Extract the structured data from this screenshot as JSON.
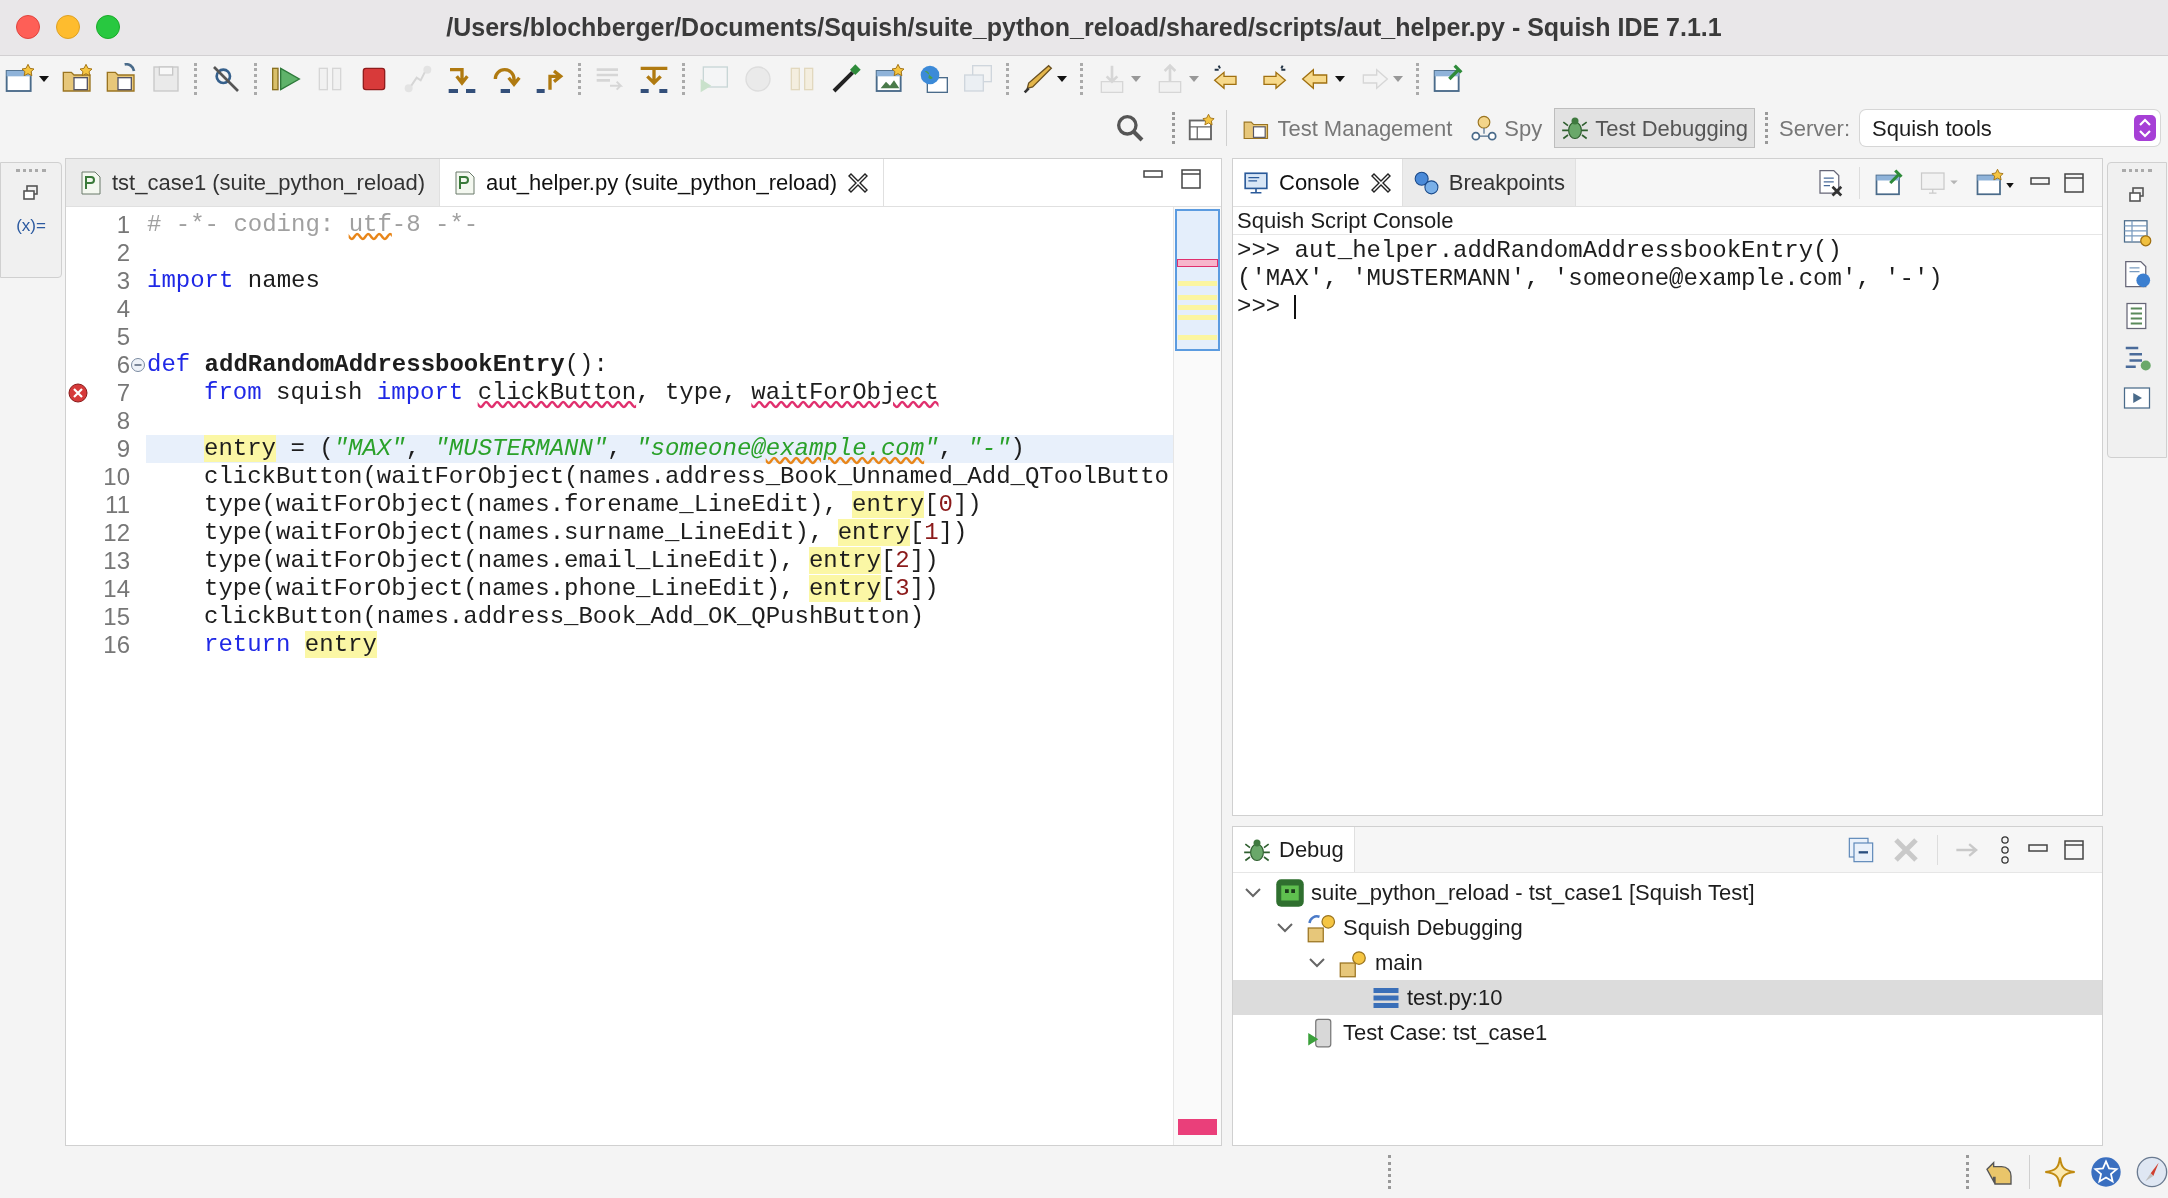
{
  "window": {
    "title": "/Users/blochberger/Documents/Squish/suite_python_reload/shared/scripts/aut_helper.py - Squish IDE 7.1.1"
  },
  "toolbar": [
    {
      "kind": "window-new",
      "disabled": false,
      "dropdown": true
    },
    {
      "kind": "folder-new",
      "disabled": false,
      "dropdown": false
    },
    {
      "kind": "folder-open",
      "disabled": false,
      "dropdown": false
    },
    {
      "kind": "save",
      "disabled": true,
      "dropdown": false
    },
    {
      "kind": "separator"
    },
    {
      "kind": "search-off",
      "disabled": false,
      "dropdown": false
    },
    {
      "kind": "separator"
    },
    {
      "kind": "run",
      "disabled": false,
      "dropdown": false
    },
    {
      "kind": "pause",
      "disabled": true,
      "dropdown": false
    },
    {
      "kind": "stop",
      "disabled": false,
      "dropdown": false
    },
    {
      "kind": "disconnect",
      "disabled": true,
      "dropdown": false
    },
    {
      "kind": "step-into",
      "disabled": false,
      "dropdown": false
    },
    {
      "kind": "step-over",
      "disabled": false,
      "dropdown": false
    },
    {
      "kind": "step-return",
      "disabled": false,
      "dropdown": false
    },
    {
      "kind": "separator"
    },
    {
      "kind": "list",
      "disabled": true,
      "dropdown": false
    },
    {
      "kind": "step-all",
      "disabled": false,
      "dropdown": false
    },
    {
      "kind": "separator"
    },
    {
      "kind": "record-window",
      "disabled": true,
      "dropdown": false
    },
    {
      "kind": "record",
      "disabled": true,
      "dropdown": false
    },
    {
      "kind": "pause-gold",
      "disabled": true,
      "dropdown": false
    },
    {
      "kind": "eyedropper",
      "disabled": false,
      "dropdown": false
    },
    {
      "kind": "image-new",
      "disabled": false,
      "dropdown": false
    },
    {
      "kind": "globe",
      "disabled": false,
      "dropdown": false
    },
    {
      "kind": "windows",
      "disabled": true,
      "dropdown": false
    },
    {
      "kind": "separator"
    },
    {
      "kind": "pen",
      "disabled": false,
      "dropdown": true
    },
    {
      "kind": "separator"
    },
    {
      "kind": "import",
      "disabled": true,
      "dropdown": true
    },
    {
      "kind": "export",
      "disabled": true,
      "dropdown": true
    },
    {
      "kind": "back-star",
      "disabled": false,
      "dropdown": false
    },
    {
      "kind": "forward-star",
      "disabled": false,
      "dropdown": false
    },
    {
      "kind": "back",
      "disabled": false,
      "dropdown": true
    },
    {
      "kind": "forward",
      "disabled": true,
      "dropdown": true
    },
    {
      "kind": "separator"
    },
    {
      "kind": "pin-window",
      "disabled": false,
      "dropdown": false
    }
  ],
  "perspectives": [
    {
      "label": "Test Management",
      "kind": "folder",
      "selected": false
    },
    {
      "label": "Spy",
      "kind": "spy",
      "selected": false
    },
    {
      "label": "Test Debugging",
      "kind": "bug",
      "selected": true
    }
  ],
  "server": {
    "label": "Server:",
    "value": "Squish tools"
  },
  "left_strip": {
    "label": "(x)="
  },
  "editor": {
    "tabs": [
      {
        "label": "tst_case1 (suite_python_reload)",
        "selected": false,
        "closable": false
      },
      {
        "label": "aut_helper.py (suite_python_reload)",
        "selected": true,
        "closable": true
      }
    ],
    "lines": [
      {
        "number": "1",
        "current": false,
        "error": false,
        "fold": false,
        "indented": false,
        "tokens": [
          {
            "kind": "comment",
            "text": "# -*- coding: "
          },
          {
            "kind": "comment",
            "text": "utf",
            "warning": true
          },
          {
            "kind": "comment",
            "text": "-8 -*-"
          }
        ]
      },
      {
        "number": "2",
        "error": false,
        "fold": false
      },
      {
        "number": "3",
        "current": false,
        "error": false,
        "fold": false,
        "indented": false,
        "tokens": [
          {
            "kind": "keyword",
            "text": "import"
          },
          {
            "kind": "plain",
            "text": " names"
          }
        ]
      },
      {
        "number": "4",
        "error": false,
        "fold": false
      },
      {
        "number": "5",
        "error": false,
        "fold": false
      },
      {
        "number": "6",
        "current": false,
        "error": false,
        "fold": true,
        "indented": false,
        "tokens": [
          {
            "kind": "keyword",
            "text": "def "
          },
          {
            "kind": "defname",
            "text": "addRandomAddressbookEntry"
          },
          {
            "kind": "plain",
            "text": "():"
          }
        ]
      },
      {
        "number": "7",
        "current": false,
        "error": true,
        "fold": false,
        "indented": true,
        "tokens": [
          {
            "kind": "keyword",
            "text": "from"
          },
          {
            "kind": "plain",
            "text": " squish "
          },
          {
            "kind": "keyword",
            "text": "import "
          },
          {
            "kind": "plain",
            "text": "clickButton",
            "error": true
          },
          {
            "kind": "plain",
            "text": ", type, "
          },
          {
            "kind": "plain",
            "text": "waitForObject",
            "error": true
          }
        ]
      },
      {
        "number": "8",
        "error": false,
        "fold": false
      },
      {
        "number": "9",
        "current": true,
        "error": false,
        "fold": false,
        "indented": true,
        "tokens": [
          {
            "kind": "occurrence",
            "text": "entry"
          },
          {
            "kind": "plain",
            "text": " = ("
          },
          {
            "kind": "string",
            "text": "\"MAX\""
          },
          {
            "kind": "plain",
            "text": ", "
          },
          {
            "kind": "string",
            "text": "\"MUSTERMANN\""
          },
          {
            "kind": "plain",
            "text": ", "
          },
          {
            "kind": "string",
            "text": "\"someone@"
          },
          {
            "kind": "string",
            "text": "example.com",
            "warning": true
          },
          {
            "kind": "string",
            "text": "\""
          },
          {
            "kind": "plain",
            "text": ", "
          },
          {
            "kind": "string",
            "text": "\"-\""
          },
          {
            "kind": "plain",
            "text": ")"
          }
        ]
      },
      {
        "number": "10",
        "current": false,
        "error": false,
        "fold": false,
        "indented": true,
        "tokens": [
          {
            "kind": "plain",
            "text": "clickButton(waitForObject(names.address_Book_Unnamed_Add_QToolButto"
          }
        ]
      },
      {
        "number": "11",
        "current": false,
        "error": false,
        "fold": false,
        "indented": true,
        "tokens": [
          {
            "kind": "plain",
            "text": "type(waitForObject(names.forename_LineEdit), "
          },
          {
            "kind": "occurrence",
            "text": "entry"
          },
          {
            "kind": "plain",
            "text": "["
          },
          {
            "kind": "number",
            "text": "0"
          },
          {
            "kind": "plain",
            "text": "])"
          }
        ]
      },
      {
        "number": "12",
        "current": false,
        "error": false,
        "fold": false,
        "indented": true,
        "tokens": [
          {
            "kind": "plain",
            "text": "type(waitForObject(names.surname_LineEdit), "
          },
          {
            "kind": "occurrence",
            "text": "entry"
          },
          {
            "kind": "plain",
            "text": "["
          },
          {
            "kind": "number",
            "text": "1"
          },
          {
            "kind": "plain",
            "text": "])"
          }
        ]
      },
      {
        "number": "13",
        "current": false,
        "error": false,
        "fold": false,
        "indented": true,
        "tokens": [
          {
            "kind": "plain",
            "text": "type(waitForObject(names.email_LineEdit), "
          },
          {
            "kind": "occurrence",
            "text": "entry"
          },
          {
            "kind": "plain",
            "text": "["
          },
          {
            "kind": "number",
            "text": "2"
          },
          {
            "kind": "plain",
            "text": "])"
          }
        ]
      },
      {
        "number": "14",
        "current": false,
        "error": false,
        "fold": false,
        "indented": true,
        "tokens": [
          {
            "kind": "plain",
            "text": "type(waitForObject(names.phone_LineEdit), "
          },
          {
            "kind": "occurrence",
            "text": "entry"
          },
          {
            "kind": "plain",
            "text": "["
          },
          {
            "kind": "number",
            "text": "3"
          },
          {
            "kind": "plain",
            "text": "])"
          }
        ]
      },
      {
        "number": "15",
        "current": false,
        "error": false,
        "fold": false,
        "indented": true,
        "tokens": [
          {
            "kind": "plain",
            "text": "clickButton(names.address_Book_Add_OK_QPushButton)"
          }
        ]
      },
      {
        "number": "16",
        "current": false,
        "error": false,
        "fold": false,
        "indented": true,
        "tokens": [
          {
            "kind": "keyword",
            "text": "return "
          },
          {
            "kind": "occurrence",
            "text": "entry"
          }
        ]
      }
    ]
  },
  "console": {
    "tabs": [
      {
        "label": "Console",
        "kind": "console",
        "selected": true,
        "closable": true
      },
      {
        "label": "Breakpoints",
        "kind": "breakpoints",
        "selected": false,
        "closable": false
      }
    ],
    "title": "Squish Script Console",
    "lines": [
      ">>> aut_helper.addRandomAddressbookEntry()",
      "('MAX', 'MUSTERMANN', 'someone@example.com', '-')",
      ">>>"
    ]
  },
  "debug": {
    "tab": "Debug",
    "tree": [
      {
        "label": "suite_python_reload - tst_case1 [Squish Test]",
        "kind": "suite",
        "selected": false,
        "expanded": true,
        "children": [
          {
            "label": "Squish Debugging",
            "kind": "process",
            "selected": false,
            "expanded": true,
            "children": [
              {
                "label": "main",
                "kind": "thread",
                "selected": false,
                "expanded": true,
                "children": [
                  {
                    "label": "test.py:10",
                    "kind": "frame",
                    "selected": true
                  }
                ]
              }
            ]
          },
          {
            "label": "Test Case: tst_case1",
            "kind": "testcase",
            "selected": false
          }
        ]
      }
    ]
  }
}
